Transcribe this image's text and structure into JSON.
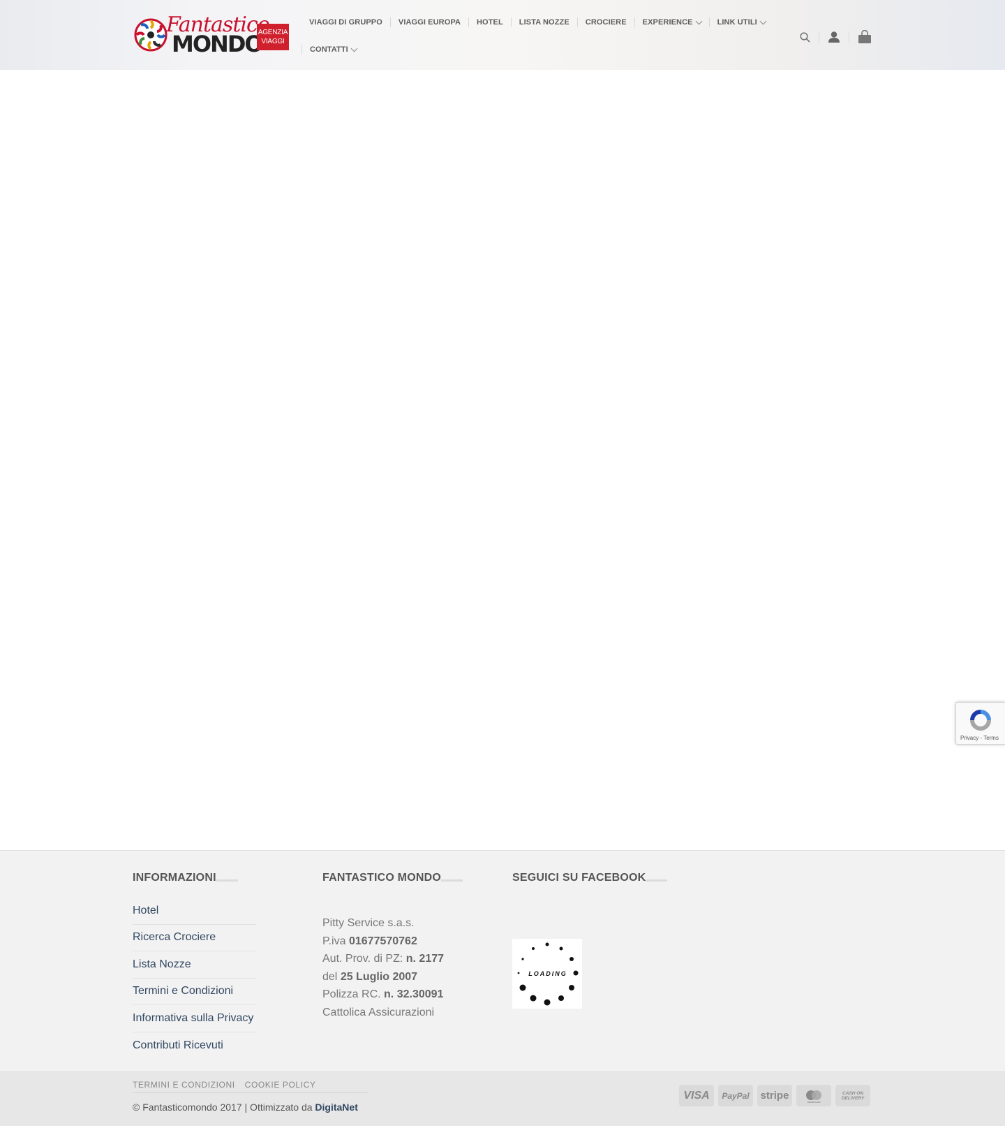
{
  "logo": {
    "word1": "Fantastico",
    "word2": "MONDO",
    "badge_line1": "AGENZIA",
    "badge_line2": "VIAGGI",
    "brand_color": "#c8102e"
  },
  "nav": {
    "row1": [
      {
        "label": "VIAGGI DI GRUPPO",
        "dropdown": false
      },
      {
        "label": "VIAGGI EUROPA",
        "dropdown": false
      },
      {
        "label": "HOTEL",
        "dropdown": false
      },
      {
        "label": "LISTA NOZZE",
        "dropdown": false
      },
      {
        "label": "CROCIERE",
        "dropdown": false
      },
      {
        "label": "EXPERIENCE",
        "dropdown": true
      },
      {
        "label": "LINK UTILI",
        "dropdown": true
      }
    ],
    "row2": [
      {
        "label": "CONTATTI",
        "dropdown": true
      }
    ]
  },
  "header_icons": [
    "search-icon",
    "account-icon",
    "cart-icon"
  ],
  "footer": {
    "informazioni": {
      "title": "INFORMAZIONI",
      "links": [
        "Hotel",
        "Ricerca Crociere",
        "Lista Nozze",
        "Termini e Condizioni",
        "Informativa sulla Privacy",
        "Contributi Ricevuti"
      ]
    },
    "fantastico_mondo": {
      "title": "FANTASTICO MONDO",
      "company": "Pitty Service s.a.s.",
      "piva_label": "P.iva",
      "piva_value": "01677570762",
      "aut_label": "Aut. Prov. di PZ:",
      "aut_value": "n. 2177",
      "del_label": "del",
      "del_value": "25 Luglio 2007",
      "polizza_label": "Polizza RC.",
      "polizza_value": "n. 32.30091",
      "insurer": "Cattolica Assicurazioni"
    },
    "facebook": {
      "title": "SEGUICI SU FACEBOOK",
      "loading_text": "LOADING"
    }
  },
  "subfooter": {
    "links": [
      "TERMINI E CONDIZIONI",
      "COOKIE POLICY"
    ],
    "copyright_prefix": "© Fantasticomondo 2017 | Ottimizzato da",
    "copyright_brand": "DigitaNet",
    "payments": [
      "VISA",
      "PayPal",
      "stripe",
      "mastercard",
      "CASH ON DELIVERY"
    ]
  },
  "recaptcha": {
    "text": "Privacy - Terms"
  }
}
